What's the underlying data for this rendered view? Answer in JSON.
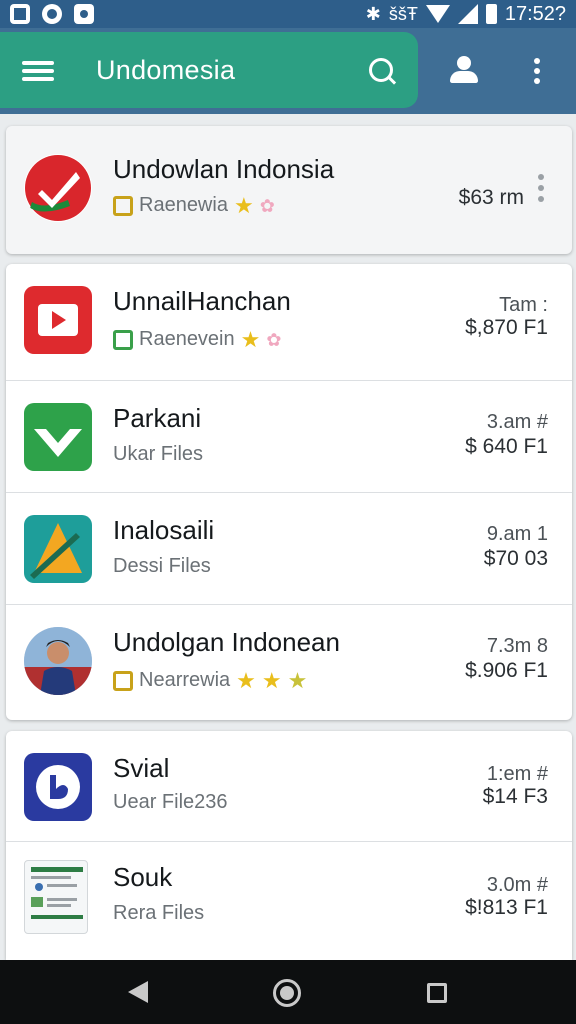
{
  "status_bar": {
    "bluetooth_glyph": "✱",
    "signal_text": "ššŦ",
    "time": "17:52?"
  },
  "app_bar": {
    "title": "Undomesia"
  },
  "list": [
    {
      "name": "Undowlan Indonsia",
      "subtitle": "Raenewia",
      "badge_color": "#c8a21a",
      "stars": [
        "★",
        "✿"
      ],
      "time": "",
      "price": "$63 rm",
      "icon_name": "red-check-icon"
    },
    {
      "name": "UnnailHanchan",
      "subtitle": "Raenevein",
      "badge_color": "#3aa04a",
      "stars": [
        "★",
        "✿"
      ],
      "time": "Tam :",
      "price": "$,870 F1",
      "icon_name": "red-play-icon"
    },
    {
      "name": "Parkani",
      "subtitle": "Ukar Files",
      "time": "3.am #",
      "price": "$ 640 F1",
      "icon_name": "green-check-icon"
    },
    {
      "name": "Inalosaili",
      "subtitle": "Dessi Files",
      "time": "9.am 1",
      "price": "$70 03",
      "icon_name": "teal-kite-icon"
    },
    {
      "name": "Undolgan Indonean",
      "subtitle": "Nearrewia",
      "badge_color": "#c8a21a",
      "stars": [
        "★",
        "★",
        "★"
      ],
      "time": "7.3m 8",
      "price": "$.906 F1",
      "icon_name": "person-photo-icon"
    },
    {
      "name": "Svial",
      "subtitle": "Uear File236",
      "time": "1:em #",
      "price": "$14 F3",
      "icon_name": "blue-logo-icon"
    },
    {
      "name": "Souk",
      "subtitle": "Rera Files",
      "time": "3.0m #",
      "price": "$!813 F1",
      "icon_name": "document-thumbnail-icon"
    }
  ]
}
